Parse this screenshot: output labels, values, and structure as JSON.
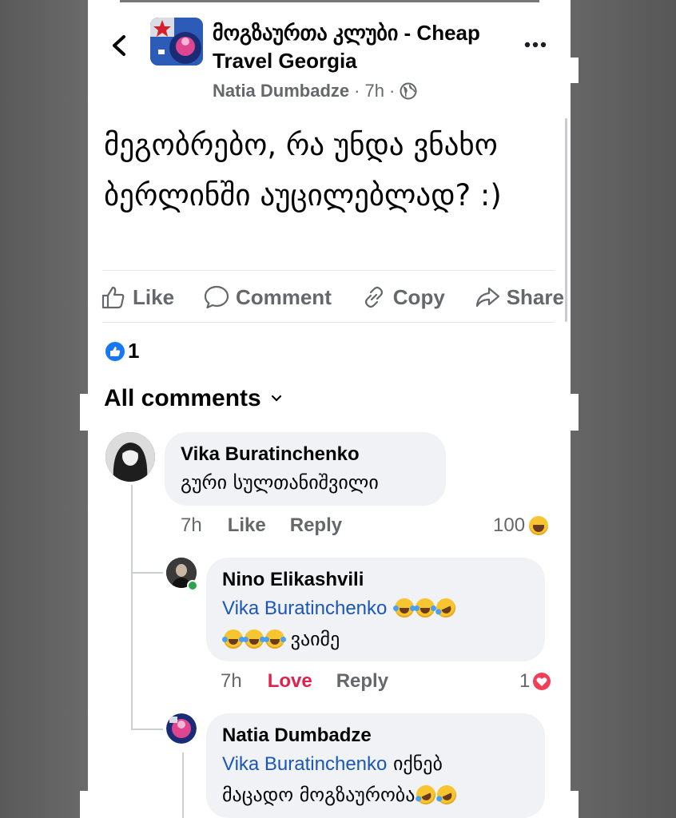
{
  "post": {
    "group_name": "მოგზაურთა კლუბი - Cheap Travel Georgia",
    "author": "Natia Dumbadze",
    "time": "7h",
    "text": "მეგობრებო, რა უნდა ვნახო ბერლინში აუცილებლად? :)"
  },
  "actions": {
    "like": "Like",
    "comment": "Comment",
    "copy": "Copy",
    "share": "Share"
  },
  "reactions": {
    "count": "1"
  },
  "comments_header": "All comments",
  "comments": [
    {
      "name": "Vika Buratinchenko",
      "text": "გური სულთანიშვილი",
      "time": "7h",
      "like": "Like",
      "reply": "Reply",
      "reaction_count": "100"
    },
    {
      "name": "Nino Elikashvili",
      "mention": "Vika Buratinchenko",
      "text_tail": "ვაიმე",
      "time": "7h",
      "like": "Love",
      "reply": "Reply",
      "reaction_count": "1"
    },
    {
      "name": "Natia Dumbadze",
      "mention": "Vika Buratinchenko",
      "text_after": "იქნებ",
      "text_line2": "მაცადო მოგზაურობა"
    }
  ],
  "icons": {
    "back": "chevron-left-icon",
    "more": "more-dots-icon",
    "globe": "globe-icon",
    "like": "thumbs-up-icon",
    "comment": "comment-bubble-icon",
    "copy": "link-icon",
    "share": "share-arrow-icon",
    "chevron": "chevron-down-icon"
  },
  "colors": {
    "link": "#1a57b8",
    "love": "#e4214c",
    "like_blue": "#1877f2",
    "muted": "#65676b"
  }
}
